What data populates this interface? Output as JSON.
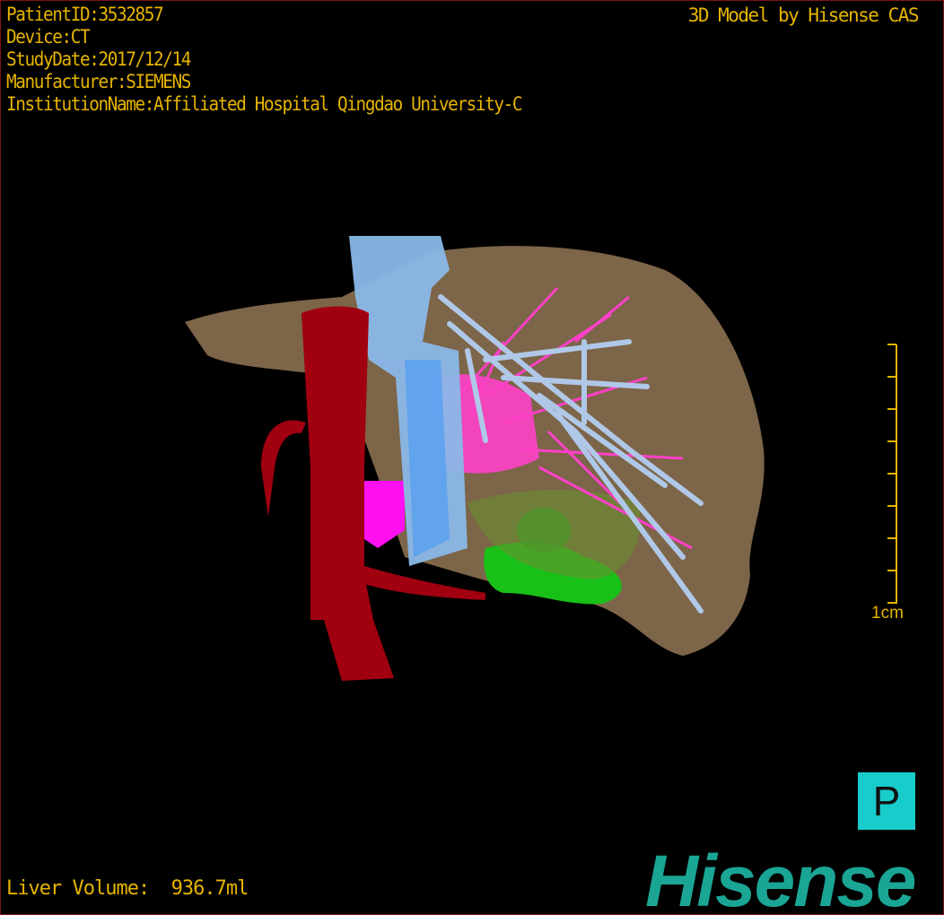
{
  "header": {
    "patient_id": "PatientID:3532857",
    "device": "Device:CT",
    "study_date": "StudyDate:2017/12/14",
    "manufacturer": "Manufacturer:SIEMENS",
    "institution": "InstitutionName:Affiliated Hospital Qingdao University-C",
    "credit": "3D Model by Hisense CAS"
  },
  "scale_bar": {
    "label": "1cm"
  },
  "orientation": {
    "label": "P"
  },
  "footer": {
    "liver_volume": "Liver Volume:  936.7ml"
  },
  "logo": {
    "text": "Hisense"
  },
  "colors": {
    "text": "#e6b400",
    "liver": "#8a7050",
    "ivc": "#a00010",
    "portal_vein": "#8ab8e8",
    "hepatic_vessel": "#ff40c8",
    "lesion": "#22c022",
    "orientation_box": "#19cccc",
    "logo": "#1aa595"
  }
}
